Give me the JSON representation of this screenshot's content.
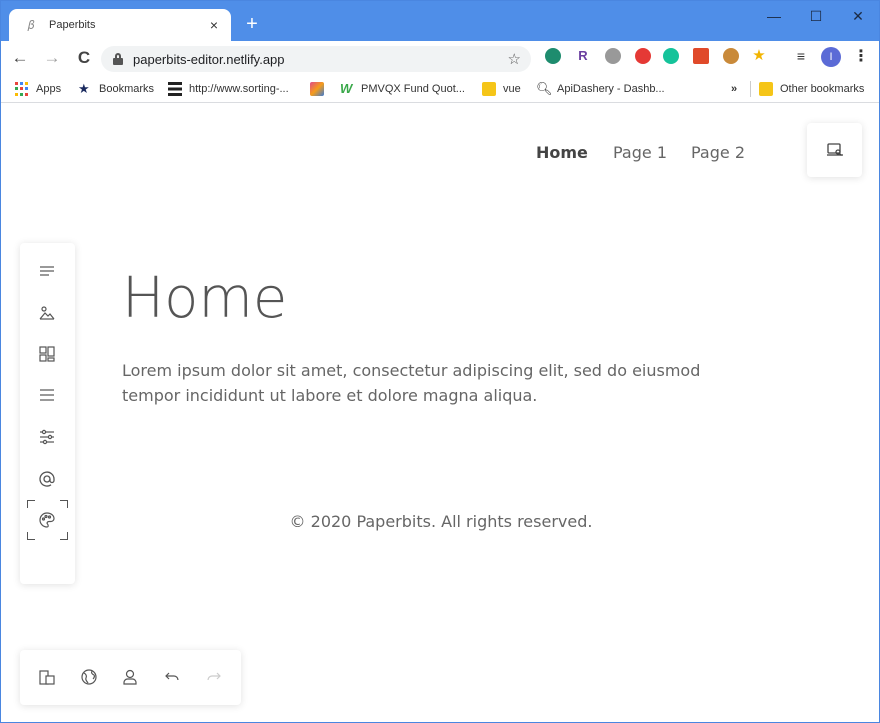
{
  "browser": {
    "tab_title": "Paperbits",
    "tab_close": "×",
    "new_tab": "+",
    "url": "paperbits-editor.netlify.app",
    "profile_initial": "I",
    "window_controls": {
      "minimize": "—",
      "maximize": "☐",
      "close": "✕"
    },
    "nav": {
      "back": "←",
      "forward": "→",
      "reload": "C"
    },
    "accent_color": "#4f8ee8"
  },
  "bookmarks": {
    "items": [
      {
        "label": "Apps",
        "icon": "apps-grid-icon"
      },
      {
        "label": "Bookmarks",
        "icon": "star-icon"
      },
      {
        "label": "http://www.sorting-...",
        "icon": "sorting-icon"
      },
      {
        "label": "",
        "icon": "image-icon"
      },
      {
        "label": "PMVQX Fund Quot...",
        "icon": "w-logo-icon"
      },
      {
        "label": "vue",
        "icon": "folder-icon"
      },
      {
        "label": "ApiDashery - Dashb...",
        "icon": "magnifier-icon"
      }
    ],
    "overflow": "»",
    "other": "Other bookmarks"
  },
  "site": {
    "nav": [
      {
        "label": "Home",
        "active": true
      },
      {
        "label": "Page 1",
        "active": false
      },
      {
        "label": "Page 2",
        "active": false
      }
    ],
    "heading": "Home",
    "paragraph": "Lorem ipsum dolor sit amet, consectetur adipiscing elit, sed do eiusmod tempor incididunt ut labore et dolore magna aliqua.",
    "footer": "© 2020 Paperbits. All rights reserved."
  },
  "editor": {
    "left_toolbar": [
      "text-icon",
      "media-icon",
      "widgets-icon",
      "menu-icon",
      "settings-icon",
      "email-icon",
      "theme-palette-icon"
    ],
    "bottom_toolbar": [
      "devices-icon",
      "globe-icon",
      "user-icon",
      "undo-icon",
      "redo-icon"
    ],
    "top_right": "site-search-icon"
  }
}
